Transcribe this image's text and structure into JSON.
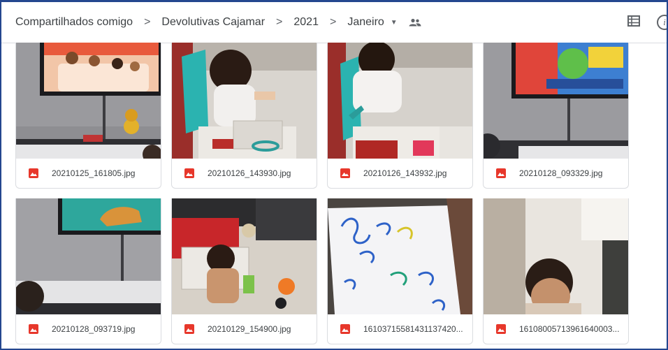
{
  "breadcrumb": {
    "items": [
      "Compartilhados comigo",
      "Devolutivas Cajamar",
      "2021",
      "Janeiro"
    ],
    "separator": ">",
    "dropdown_glyph": "▼"
  },
  "toolbar": {
    "shared_icon": "people-icon",
    "list_view_icon": "list-view-icon",
    "info_icon": "info-icon",
    "info_glyph": "i"
  },
  "files": [
    {
      "name": "20210125_161805.jpg",
      "icon": "image-icon"
    },
    {
      "name": "20210126_143930.jpg",
      "icon": "image-icon"
    },
    {
      "name": "20210126_143932.jpg",
      "icon": "image-icon"
    },
    {
      "name": "20210128_093329.jpg",
      "icon": "image-icon"
    },
    {
      "name": "20210128_093719.jpg",
      "icon": "image-icon"
    },
    {
      "name": "20210129_154900.jpg",
      "icon": "image-icon"
    },
    {
      "name": "16103715581431137420...",
      "icon": "image-icon"
    },
    {
      "name": "16108005713961640003...",
      "icon": "image-icon"
    }
  ],
  "colors": {
    "frame": "#24478f",
    "image_icon": "#e7372b",
    "text": "#3c4043"
  }
}
